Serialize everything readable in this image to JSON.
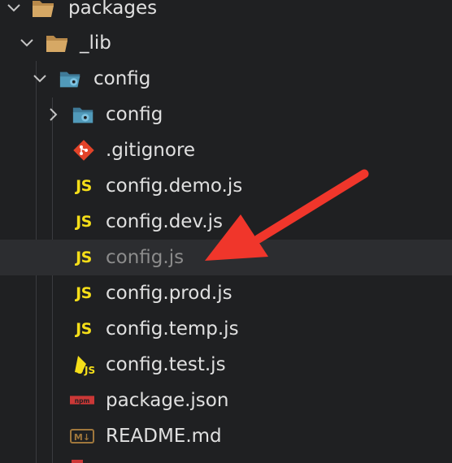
{
  "tree": {
    "rows": [
      {
        "label": "packages",
        "icon": "folder-open-icon"
      },
      {
        "label": "_lib",
        "icon": "folder-open-icon"
      },
      {
        "label": "config",
        "icon": "config-folder-icon"
      },
      {
        "label": "config",
        "icon": "config-folder-icon"
      },
      {
        "label": ".gitignore",
        "icon": "git-icon"
      },
      {
        "label": "config.demo.js",
        "icon": "js-icon"
      },
      {
        "label": "config.dev.js",
        "icon": "js-icon"
      },
      {
        "label": "config.js",
        "icon": "js-icon"
      },
      {
        "label": "config.prod.js",
        "icon": "js-icon"
      },
      {
        "label": "config.temp.js",
        "icon": "js-icon"
      },
      {
        "label": "config.test.js",
        "icon": "js-test-icon"
      },
      {
        "label": "package.json",
        "icon": "npm-icon"
      },
      {
        "label": "README.md",
        "icon": "markdown-icon"
      }
    ],
    "js_badge": "JS",
    "md_badge": "M↓",
    "npm_badge": "npm"
  },
  "annotation": {
    "color": "#f0362b",
    "icon": "red-arrow"
  },
  "colors": {
    "js": "#f5de19",
    "git": "#e24329",
    "folder": "#c59a55",
    "config_folder": "#519aba",
    "npm": "#cb3837",
    "selection": "#2c2d30"
  }
}
